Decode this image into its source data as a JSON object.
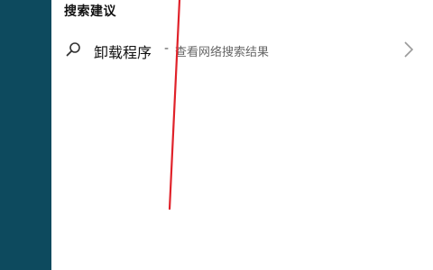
{
  "search_suggestions": {
    "heading": "搜索建议",
    "items": [
      {
        "title": "卸载程序",
        "separator": "-",
        "subtitle": "查看网络搜索结果",
        "icon": "search-icon",
        "trailing_icon": "chevron-right-icon"
      }
    ]
  },
  "colors": {
    "rail": "#0d4a5e",
    "annotation_stroke": "#e0222a"
  }
}
